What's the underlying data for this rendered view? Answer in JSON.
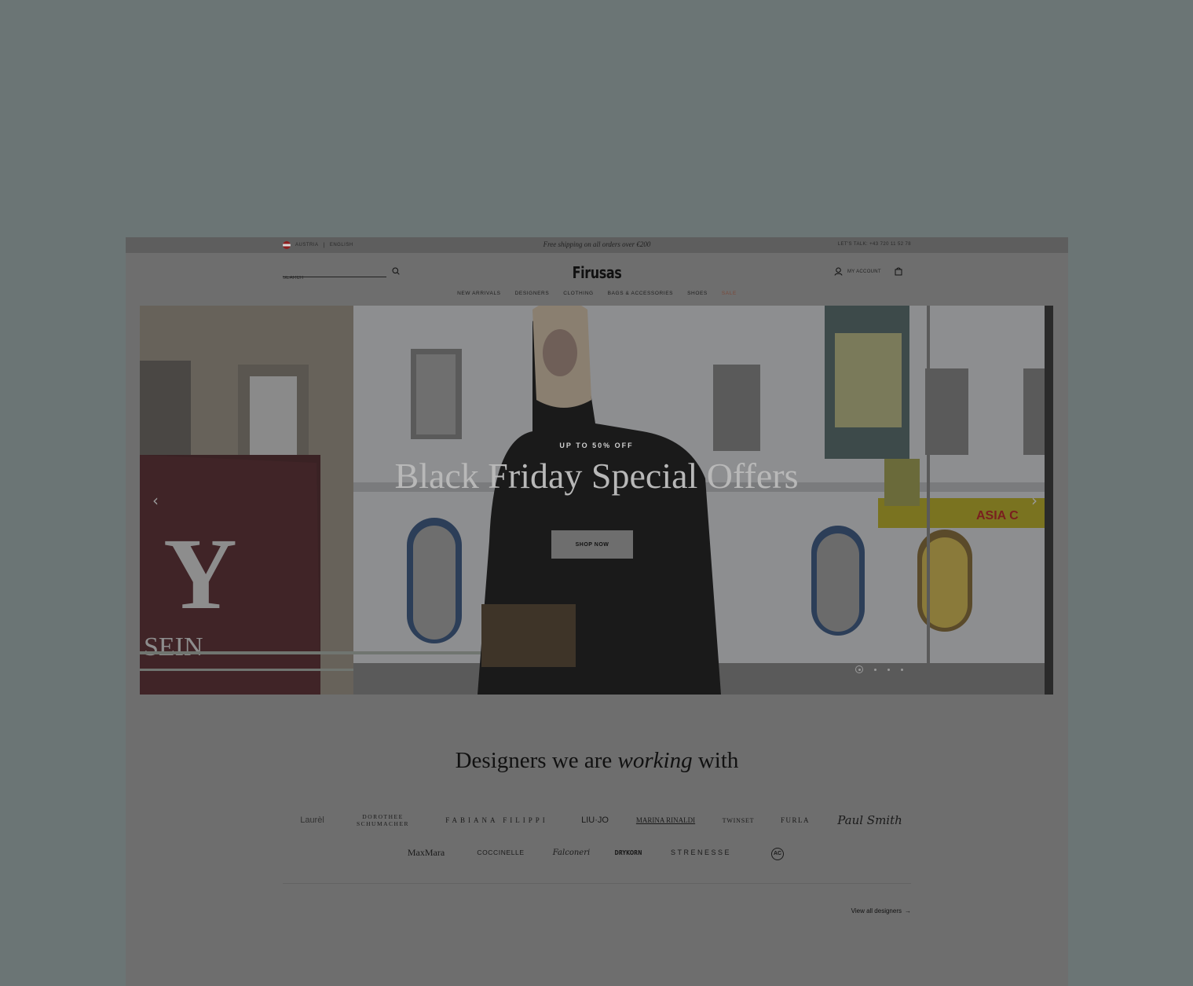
{
  "topbar": {
    "country": "AUSTRIA",
    "language": "ENGLISH",
    "promo": "Free shipping on all orders over €200",
    "talk_label": "LET'S TALK:",
    "phone": "+43 720 11 52 78"
  },
  "header": {
    "search_placeholder": "SEARCH",
    "logo": "Firusas",
    "account_label": "MY ACCOUNT"
  },
  "nav": {
    "items": [
      "NEW ARRIVALS",
      "DESIGNERS",
      "CLOTHING",
      "BAGS & ACCESSORIES",
      "SHOES",
      "SALE"
    ]
  },
  "hero": {
    "subtitle": "UP TO 50% OFF",
    "title": "Black Friday Special Offers",
    "button": "SHOP NOW",
    "slide_count": 4,
    "active_slide": 1
  },
  "designers": {
    "heading_start": "Designers we are ",
    "heading_em": "working",
    "heading_end": " with",
    "row1": [
      "Laurèl",
      "DOROTHEE SCHUMACHER",
      "FABIANA FILIPPI",
      "LIU·JO",
      "MARINA RINALDI",
      "TWINSET",
      "FURLA",
      "Paul Smith"
    ],
    "row2": [
      "MaxMara",
      "COCCINELLE",
      "Falconeri",
      "DRYKORN",
      "STRENESSE",
      "AC"
    ],
    "view_all": "View all designers"
  },
  "colors": {
    "backdrop": "#6b7575",
    "page": "#6e6e6e",
    "sale": "#7a4a3a"
  }
}
